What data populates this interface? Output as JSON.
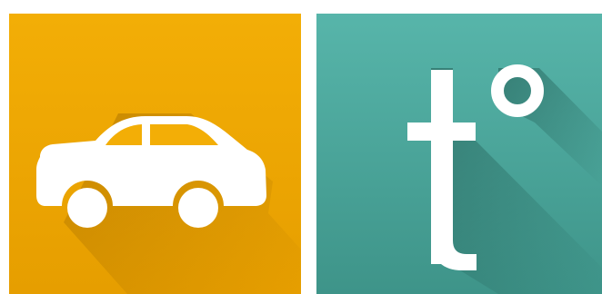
{
  "tiles": [
    {
      "name": "car-tile",
      "icon": "car-icon",
      "background_top": "#F3AE06",
      "background_bottom": "#E69E00",
      "glyph_color": "#FFFFFF",
      "shadow_color": "#B37A00"
    },
    {
      "name": "temperature-tile",
      "icon": "degree-t-icon",
      "glyph_text": "t°",
      "background_top": "#55B3A8",
      "background_bottom": "#3C9488",
      "glyph_color": "#FFFFFF",
      "shadow_color": "#2A6F66"
    }
  ]
}
